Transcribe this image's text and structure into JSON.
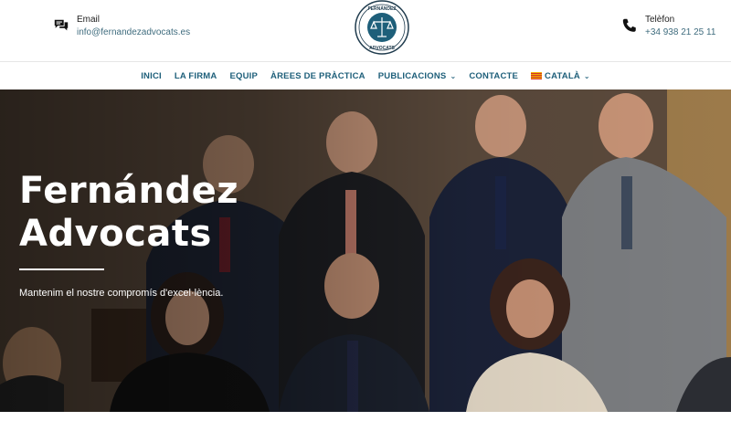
{
  "header": {
    "email": {
      "label": "Email",
      "value": "info@fernandezadvocats.es",
      "icon": "chat-bubbles-icon"
    },
    "phone": {
      "label": "Telèfon",
      "value": "+34 938 21 25 11",
      "icon": "phone-icon"
    },
    "logo": {
      "top_text": "FERNÁNDEZ",
      "bottom_text": "ADVOCATS",
      "icon": "scales-of-justice-logo"
    }
  },
  "nav": {
    "items": [
      {
        "label": "INICI"
      },
      {
        "label": "LA FIRMA"
      },
      {
        "label": "EQUIP"
      },
      {
        "label": "ÀREES DE PRÀCTICA"
      },
      {
        "label": "PUBLICACIONS",
        "dropdown": true
      },
      {
        "label": "CONTACTE"
      },
      {
        "label": "CATALÀ",
        "dropdown": true,
        "flag": "catalan-flag-icon"
      }
    ]
  },
  "hero": {
    "title_line1": "Fernández",
    "title_line2": "Advocats",
    "subtitle": "Mantenim el nostre compromís d'excel·lència."
  },
  "colors": {
    "accent": "#1e5f7a",
    "link": "#3f6c7e",
    "hero_text": "#ffffff"
  }
}
